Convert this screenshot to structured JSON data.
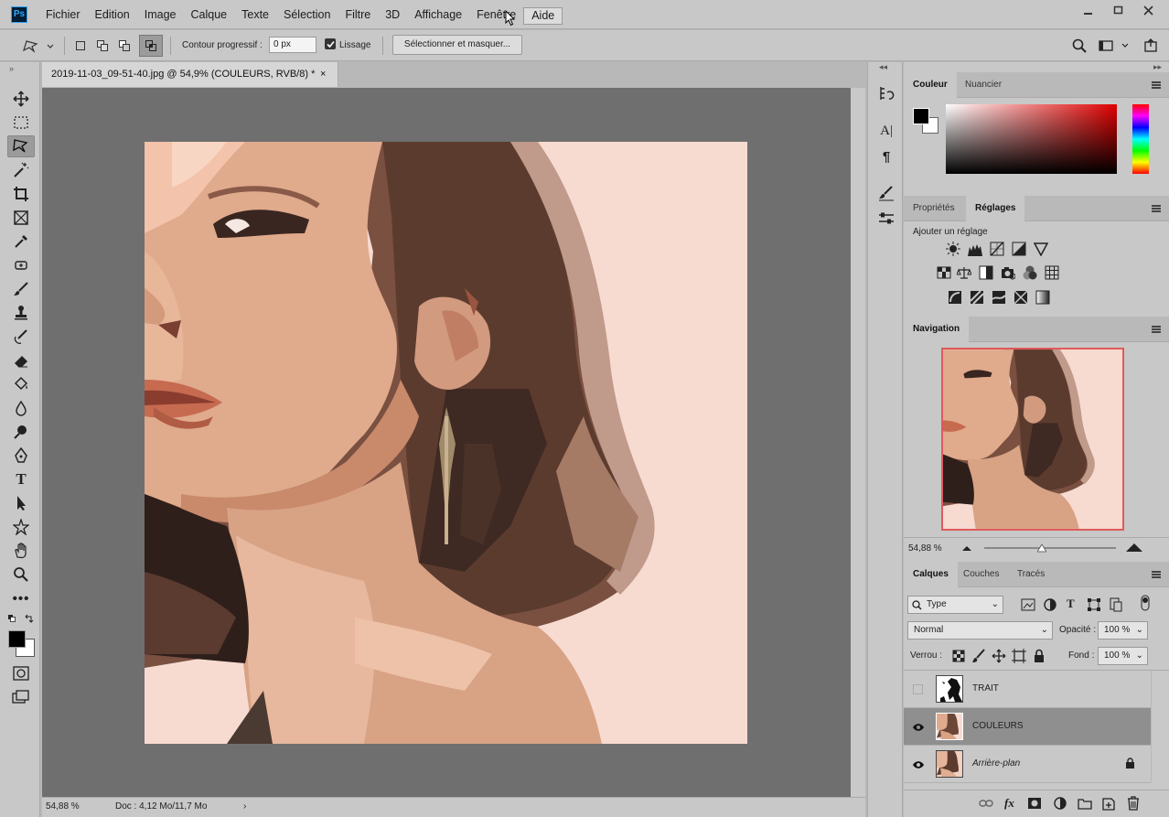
{
  "app": {
    "logo": "Ps"
  },
  "menu": [
    "Fichier",
    "Edition",
    "Image",
    "Calque",
    "Texte",
    "Sélection",
    "Filtre",
    "3D",
    "Affichage",
    "Fenêtre",
    "Aide"
  ],
  "options": {
    "feather_label": "Contour progressif :",
    "feather_value": "0 px",
    "smoothing_label": "Lissage",
    "smoothing_checked": true,
    "select_mask_label": "Sélectionner et masquer..."
  },
  "document": {
    "tab_title": "2019-11-03_09-51-40.jpg @ 54,9% (COULEURS, RVB/8) *",
    "close": "×",
    "status_zoom": "54,88 %",
    "status_doc": "Doc : 4,12 Mo/11,7 Mo",
    "status_arrow": "›"
  },
  "panels": {
    "color": {
      "tabs": [
        "Couleur",
        "Nuancier"
      ],
      "active": "Couleur"
    },
    "adjust": {
      "tabs": [
        "Propriétés",
        "Réglages"
      ],
      "active": "Réglages",
      "subtitle": "Ajouter un réglage"
    },
    "navigation": {
      "title": "Navigation",
      "zoom": "54,88 %"
    },
    "layers": {
      "tabs": [
        "Calques",
        "Couches",
        "Tracés"
      ],
      "active": "Calques",
      "filter_type": "Type",
      "blend_mode": "Normal",
      "opacity_label": "Opacité :",
      "opacity_value": "100 %",
      "lock_label": "Verrou :",
      "fill_label": "Fond :",
      "fill_value": "100 %",
      "footer_fx": "fx",
      "items": [
        {
          "name": "TRAIT",
          "visible": false,
          "selected": false,
          "locked": false
        },
        {
          "name": "COULEURS",
          "visible": true,
          "selected": true,
          "locked": false
        },
        {
          "name": "Arrière-plan",
          "visible": true,
          "selected": false,
          "locked": true
        }
      ]
    }
  },
  "colors": {
    "accent_frame": "#e05a5a",
    "skin": "#e0aa8c",
    "hair": "#6b4637",
    "background": "#f7dbd1"
  }
}
